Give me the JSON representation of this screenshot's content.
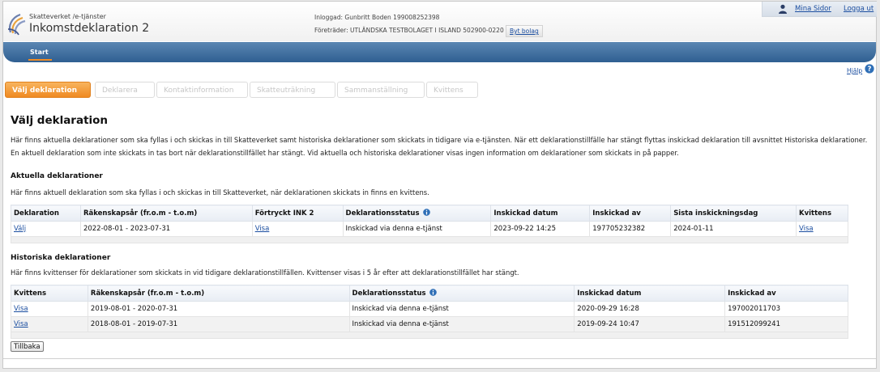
{
  "header": {
    "brand_small": "Skatteverket /e-tjänster",
    "brand_title": "Inkomstdeklaration 2",
    "login_info": "Inloggad: Gunbritt Boden 199008252398",
    "representative_info": "Företräder: UTLÄNDSKA TESTBOLAGET I ISLAND 502900-0220",
    "switch_company": "Byt bolag",
    "my_pages": "Mina Sidor",
    "logout": "Logga ut"
  },
  "nav": {
    "start": "Start"
  },
  "help": "Hjälp",
  "steps": [
    "Välj deklaration",
    "Deklarera",
    "Kontaktinformation",
    "Skatteuträkning",
    "Sammanställning",
    "Kvittens"
  ],
  "page_title": "Välj deklaration",
  "intro": "Här finns aktuella deklarationer som ska fyllas i och skickas in till Skatteverket samt historiska deklarationer som skickats in tidigare via e-tjänsten. När ett deklarationstillfälle har stängt flyttas inskickad deklaration till avsnittet Historiska deklarationer. En aktuell deklaration som inte skickats in tas bort när deklarationstillfället har stängt. Vid aktuella och historiska deklarationer visas ingen information om deklarationer som skickats in på papper.",
  "current": {
    "title": "Aktuella deklarationer",
    "description": "Här finns aktuell deklaration som ska fyllas i och skickas in till Skatteverket, när deklarationen skickats in finns en kvittens.",
    "headers": [
      "Deklaration",
      "Räkenskapsår (fr.o.m - t.o.m)",
      "Förtryckt INK 2",
      "Deklarationsstatus",
      "Inskickad datum",
      "Inskickad av",
      "Sista inskickningsdag",
      "Kvittens"
    ],
    "rows": [
      {
        "declaration": "Välj",
        "fiscal_year": "2022-08-01 - 2023-07-31",
        "preprinted": "Visa",
        "status": "Inskickad via denna e-tjänst",
        "sent_date": "2023-09-22 14:25",
        "sent_by": "197705232382",
        "deadline": "2024-01-11",
        "receipt": "Visa"
      }
    ]
  },
  "historical": {
    "title": "Historiska deklarationer",
    "description": "Här finns kvittenser för deklarationer som skickats in vid tidigare deklarationstillfällen. Kvittenser visas i 5 år efter att deklarationstillfället har stängt.",
    "headers": [
      "Kvittens",
      "Räkenskapsår (fr.o.m - t.o.m)",
      "Deklarationsstatus",
      "Inskickad datum",
      "Inskickad av"
    ],
    "rows": [
      {
        "receipt": "Visa",
        "fiscal_year": "2019-08-01 - 2020-07-31",
        "status": "Inskickad via denna e-tjänst",
        "sent_date": "2020-09-29 16:28",
        "sent_by": "197002011703"
      },
      {
        "receipt": "Visa",
        "fiscal_year": "2018-08-01 - 2019-07-31",
        "status": "Inskickad via denna e-tjänst",
        "sent_date": "2019-09-24 10:47",
        "sent_by": "191512099241"
      }
    ]
  },
  "back_button": "Tillbaka",
  "colors": {
    "accent_orange": "#ef8a22",
    "nav_blue": "#2f5f91",
    "link_blue": "#1b4ea0"
  }
}
